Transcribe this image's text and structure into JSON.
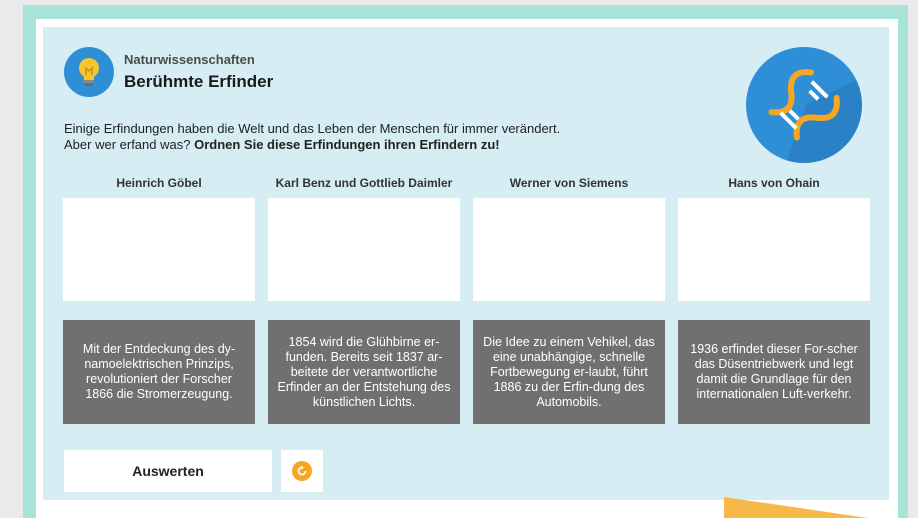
{
  "header": {
    "subtitle": "Naturwissenschaften",
    "title": "Berühmte Erfinder"
  },
  "intro": {
    "line1": "Einige Erfindungen haben die Welt und das Leben der Menschen für immer verändert.",
    "line2_plain": "Aber wer erfand was? ",
    "line2_bold": "Ordnen Sie diese Erfindungen ihren Erfindern zu!"
  },
  "inventors": [
    {
      "label": "Heinrich Göbel"
    },
    {
      "label": "Karl Benz und Gottlieb Daimler"
    },
    {
      "label": "Werner von Siemens"
    },
    {
      "label": "Hans von Ohain"
    }
  ],
  "cards": [
    {
      "text": "Mit der Entdeckung des dy-namoelektrischen Prinzips, revolutioniert der Forscher 1866 die Stromerzeugung."
    },
    {
      "text": "1854 wird die Glühbirne er-funden. Bereits seit 1837 ar-beitete der verantwortliche Erfinder an der Entstehung des künstlichen Lichts."
    },
    {
      "text": "Die Idee zu einem Vehikel, das eine unabhängige, schnelle Fortbewegung er-laubt, führt 1886 zu der Erfin-dung des Automobils."
    },
    {
      "text": "1936 erfindet dieser For-scher das Düsentriebwerk und legt damit die Grundlage für den internationalen Luft-verkehr."
    }
  ],
  "actions": {
    "evaluate_label": "Auswerten"
  },
  "icons": {
    "category": "lightbulb-icon",
    "badge": "dna-icon",
    "reset": "reset-icon"
  },
  "colors": {
    "frame": "#a8e3d8",
    "panel": "#d6edf4",
    "card": "#707070",
    "accent_blue": "#2f8fd6",
    "accent_orange": "#f5a623"
  }
}
